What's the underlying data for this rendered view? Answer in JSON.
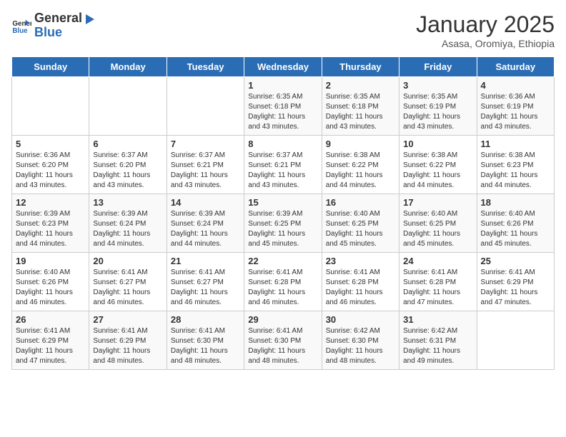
{
  "header": {
    "logo_general": "General",
    "logo_blue": "Blue",
    "month_title": "January 2025",
    "subtitle": "Asasa, Oromiya, Ethiopia"
  },
  "days_of_week": [
    "Sunday",
    "Monday",
    "Tuesday",
    "Wednesday",
    "Thursday",
    "Friday",
    "Saturday"
  ],
  "weeks": [
    [
      {
        "day": "",
        "content": ""
      },
      {
        "day": "",
        "content": ""
      },
      {
        "day": "",
        "content": ""
      },
      {
        "day": "1",
        "content": "Sunrise: 6:35 AM\nSunset: 6:18 PM\nDaylight: 11 hours\nand 43 minutes."
      },
      {
        "day": "2",
        "content": "Sunrise: 6:35 AM\nSunset: 6:18 PM\nDaylight: 11 hours\nand 43 minutes."
      },
      {
        "day": "3",
        "content": "Sunrise: 6:35 AM\nSunset: 6:19 PM\nDaylight: 11 hours\nand 43 minutes."
      },
      {
        "day": "4",
        "content": "Sunrise: 6:36 AM\nSunset: 6:19 PM\nDaylight: 11 hours\nand 43 minutes."
      }
    ],
    [
      {
        "day": "5",
        "content": "Sunrise: 6:36 AM\nSunset: 6:20 PM\nDaylight: 11 hours\nand 43 minutes."
      },
      {
        "day": "6",
        "content": "Sunrise: 6:37 AM\nSunset: 6:20 PM\nDaylight: 11 hours\nand 43 minutes."
      },
      {
        "day": "7",
        "content": "Sunrise: 6:37 AM\nSunset: 6:21 PM\nDaylight: 11 hours\nand 43 minutes."
      },
      {
        "day": "8",
        "content": "Sunrise: 6:37 AM\nSunset: 6:21 PM\nDaylight: 11 hours\nand 43 minutes."
      },
      {
        "day": "9",
        "content": "Sunrise: 6:38 AM\nSunset: 6:22 PM\nDaylight: 11 hours\nand 44 minutes."
      },
      {
        "day": "10",
        "content": "Sunrise: 6:38 AM\nSunset: 6:22 PM\nDaylight: 11 hours\nand 44 minutes."
      },
      {
        "day": "11",
        "content": "Sunrise: 6:38 AM\nSunset: 6:23 PM\nDaylight: 11 hours\nand 44 minutes."
      }
    ],
    [
      {
        "day": "12",
        "content": "Sunrise: 6:39 AM\nSunset: 6:23 PM\nDaylight: 11 hours\nand 44 minutes."
      },
      {
        "day": "13",
        "content": "Sunrise: 6:39 AM\nSunset: 6:24 PM\nDaylight: 11 hours\nand 44 minutes."
      },
      {
        "day": "14",
        "content": "Sunrise: 6:39 AM\nSunset: 6:24 PM\nDaylight: 11 hours\nand 44 minutes."
      },
      {
        "day": "15",
        "content": "Sunrise: 6:39 AM\nSunset: 6:25 PM\nDaylight: 11 hours\nand 45 minutes."
      },
      {
        "day": "16",
        "content": "Sunrise: 6:40 AM\nSunset: 6:25 PM\nDaylight: 11 hours\nand 45 minutes."
      },
      {
        "day": "17",
        "content": "Sunrise: 6:40 AM\nSunset: 6:25 PM\nDaylight: 11 hours\nand 45 minutes."
      },
      {
        "day": "18",
        "content": "Sunrise: 6:40 AM\nSunset: 6:26 PM\nDaylight: 11 hours\nand 45 minutes."
      }
    ],
    [
      {
        "day": "19",
        "content": "Sunrise: 6:40 AM\nSunset: 6:26 PM\nDaylight: 11 hours\nand 46 minutes."
      },
      {
        "day": "20",
        "content": "Sunrise: 6:41 AM\nSunset: 6:27 PM\nDaylight: 11 hours\nand 46 minutes."
      },
      {
        "day": "21",
        "content": "Sunrise: 6:41 AM\nSunset: 6:27 PM\nDaylight: 11 hours\nand 46 minutes."
      },
      {
        "day": "22",
        "content": "Sunrise: 6:41 AM\nSunset: 6:28 PM\nDaylight: 11 hours\nand 46 minutes."
      },
      {
        "day": "23",
        "content": "Sunrise: 6:41 AM\nSunset: 6:28 PM\nDaylight: 11 hours\nand 46 minutes."
      },
      {
        "day": "24",
        "content": "Sunrise: 6:41 AM\nSunset: 6:28 PM\nDaylight: 11 hours\nand 47 minutes."
      },
      {
        "day": "25",
        "content": "Sunrise: 6:41 AM\nSunset: 6:29 PM\nDaylight: 11 hours\nand 47 minutes."
      }
    ],
    [
      {
        "day": "26",
        "content": "Sunrise: 6:41 AM\nSunset: 6:29 PM\nDaylight: 11 hours\nand 47 minutes."
      },
      {
        "day": "27",
        "content": "Sunrise: 6:41 AM\nSunset: 6:29 PM\nDaylight: 11 hours\nand 48 minutes."
      },
      {
        "day": "28",
        "content": "Sunrise: 6:41 AM\nSunset: 6:30 PM\nDaylight: 11 hours\nand 48 minutes."
      },
      {
        "day": "29",
        "content": "Sunrise: 6:41 AM\nSunset: 6:30 PM\nDaylight: 11 hours\nand 48 minutes."
      },
      {
        "day": "30",
        "content": "Sunrise: 6:42 AM\nSunset: 6:30 PM\nDaylight: 11 hours\nand 48 minutes."
      },
      {
        "day": "31",
        "content": "Sunrise: 6:42 AM\nSunset: 6:31 PM\nDaylight: 11 hours\nand 49 minutes."
      },
      {
        "day": "",
        "content": ""
      }
    ]
  ]
}
